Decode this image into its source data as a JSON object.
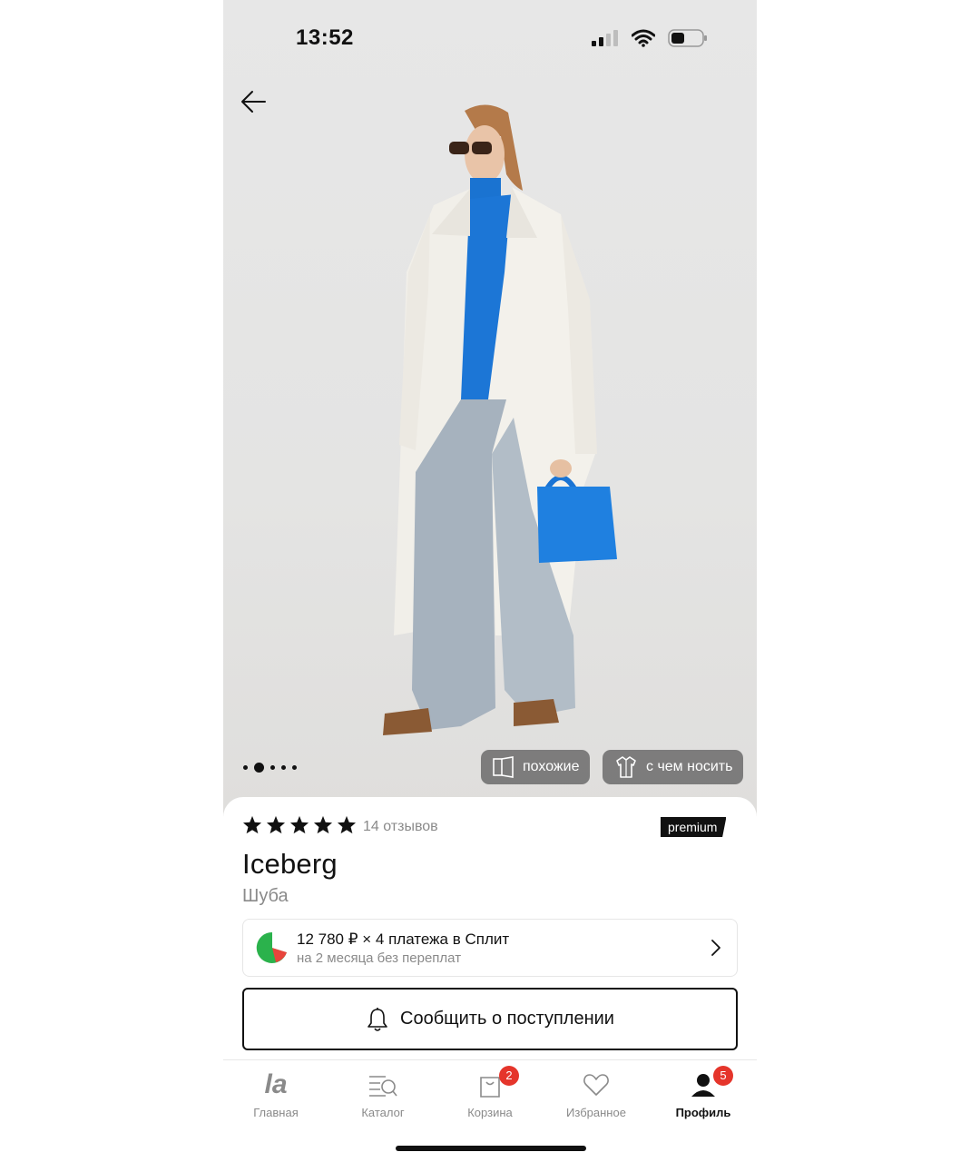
{
  "status_bar": {
    "time": "13:52"
  },
  "gallery": {
    "pages": 5,
    "active_page": 2,
    "similar_label": "похожие",
    "what_to_wear_label": "с чем носить"
  },
  "product": {
    "rating": 5,
    "reviews_label": "14 отзывов",
    "badge": "premium",
    "brand": "Iceberg",
    "title": "Шуба"
  },
  "split": {
    "line1": "12 780 ₽ × 4 платежа в Сплит",
    "line2": "на 2 месяца без переплат"
  },
  "notify_button": "Сообщить о поступлении",
  "tabbar": {
    "home": {
      "logo": "la",
      "label": "Главная"
    },
    "catalog": {
      "label": "Каталог"
    },
    "cart": {
      "label": "Корзина",
      "badge": "2"
    },
    "favorites": {
      "label": "Избранное"
    },
    "profile": {
      "label": "Профиль",
      "badge": "5"
    }
  },
  "colors": {
    "accent": "#111111",
    "badge": "#e5352b",
    "muted": "#8a8a8a"
  }
}
